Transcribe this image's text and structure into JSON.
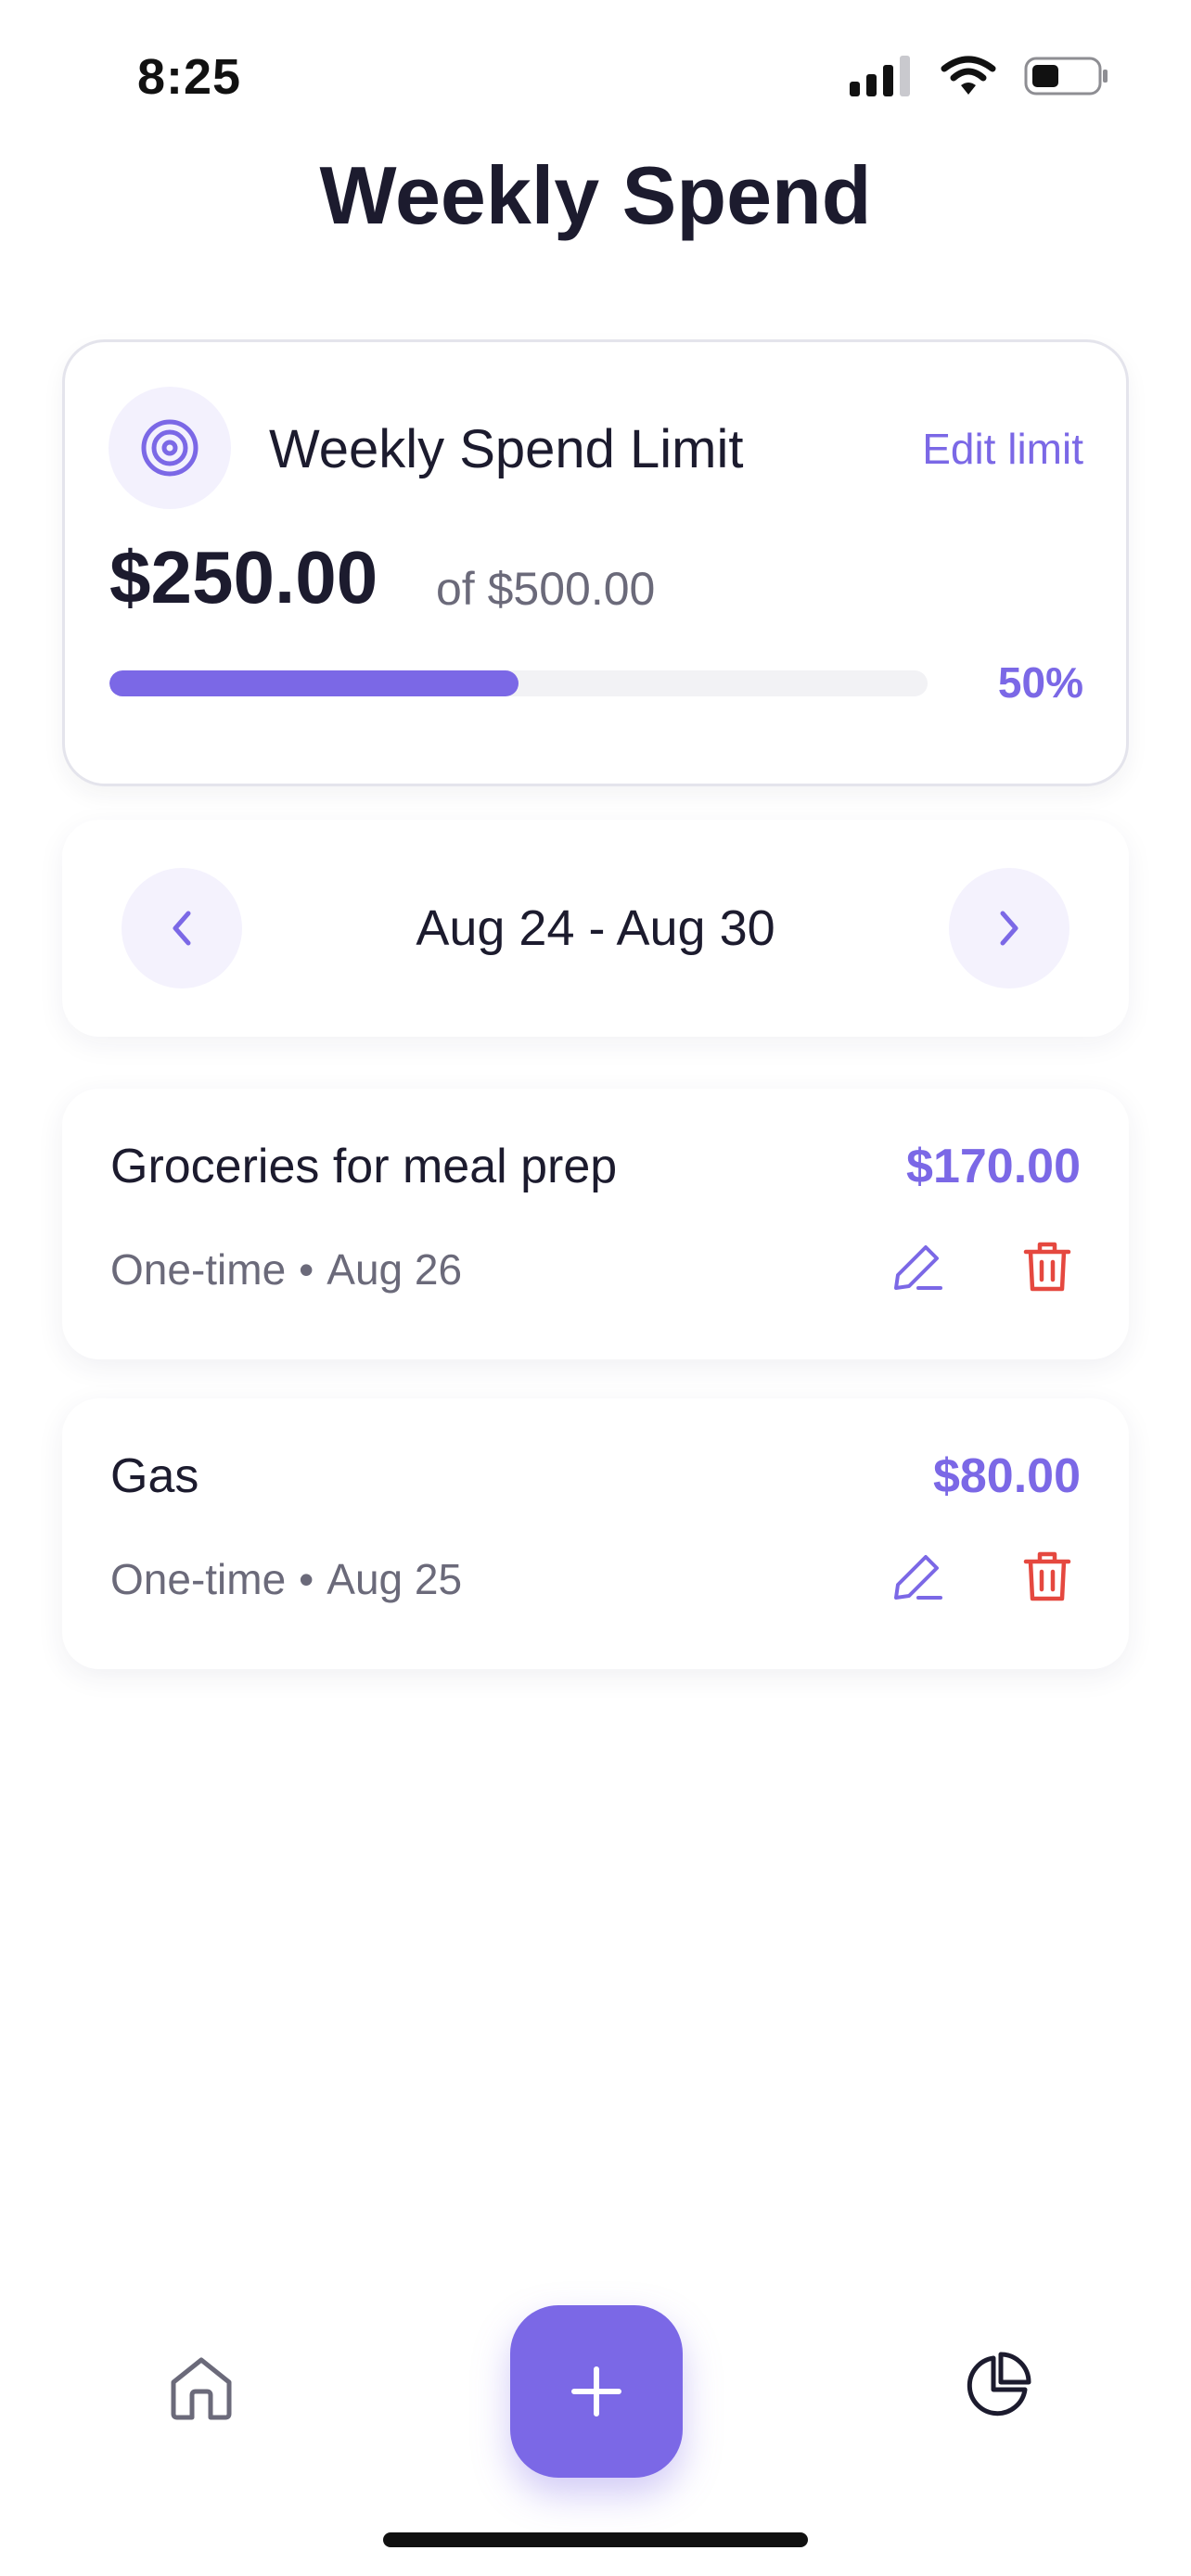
{
  "status_bar": {
    "time": "8:25"
  },
  "header": {
    "title": "Weekly Spend"
  },
  "limit_card": {
    "title": "Weekly Spend Limit",
    "edit_label": "Edit limit",
    "spent": "$250.00",
    "limit": "of $500.00",
    "progress_percent": "50%",
    "progress_value": 50,
    "icon": "target-icon"
  },
  "week_nav": {
    "range": "Aug 24 - Aug 30",
    "prev_icon": "chevron-left-icon",
    "next_icon": "chevron-right-icon"
  },
  "expenses": [
    {
      "name": "Groceries for meal prep",
      "amount": "$170.00",
      "type": "One-time",
      "separator": "•",
      "date": "Aug 26"
    },
    {
      "name": "Gas",
      "amount": "$80.00",
      "type": "One-time",
      "separator": "•",
      "date": "Aug 25"
    }
  ],
  "bottom_nav": {
    "home_icon": "home-icon",
    "add_icon": "plus-icon",
    "chart_icon": "pie-chart-icon"
  },
  "colors": {
    "accent": "#7b68e6",
    "danger": "#e5483f",
    "text_primary": "#1c1b2e",
    "text_secondary": "#6b6a7a"
  }
}
